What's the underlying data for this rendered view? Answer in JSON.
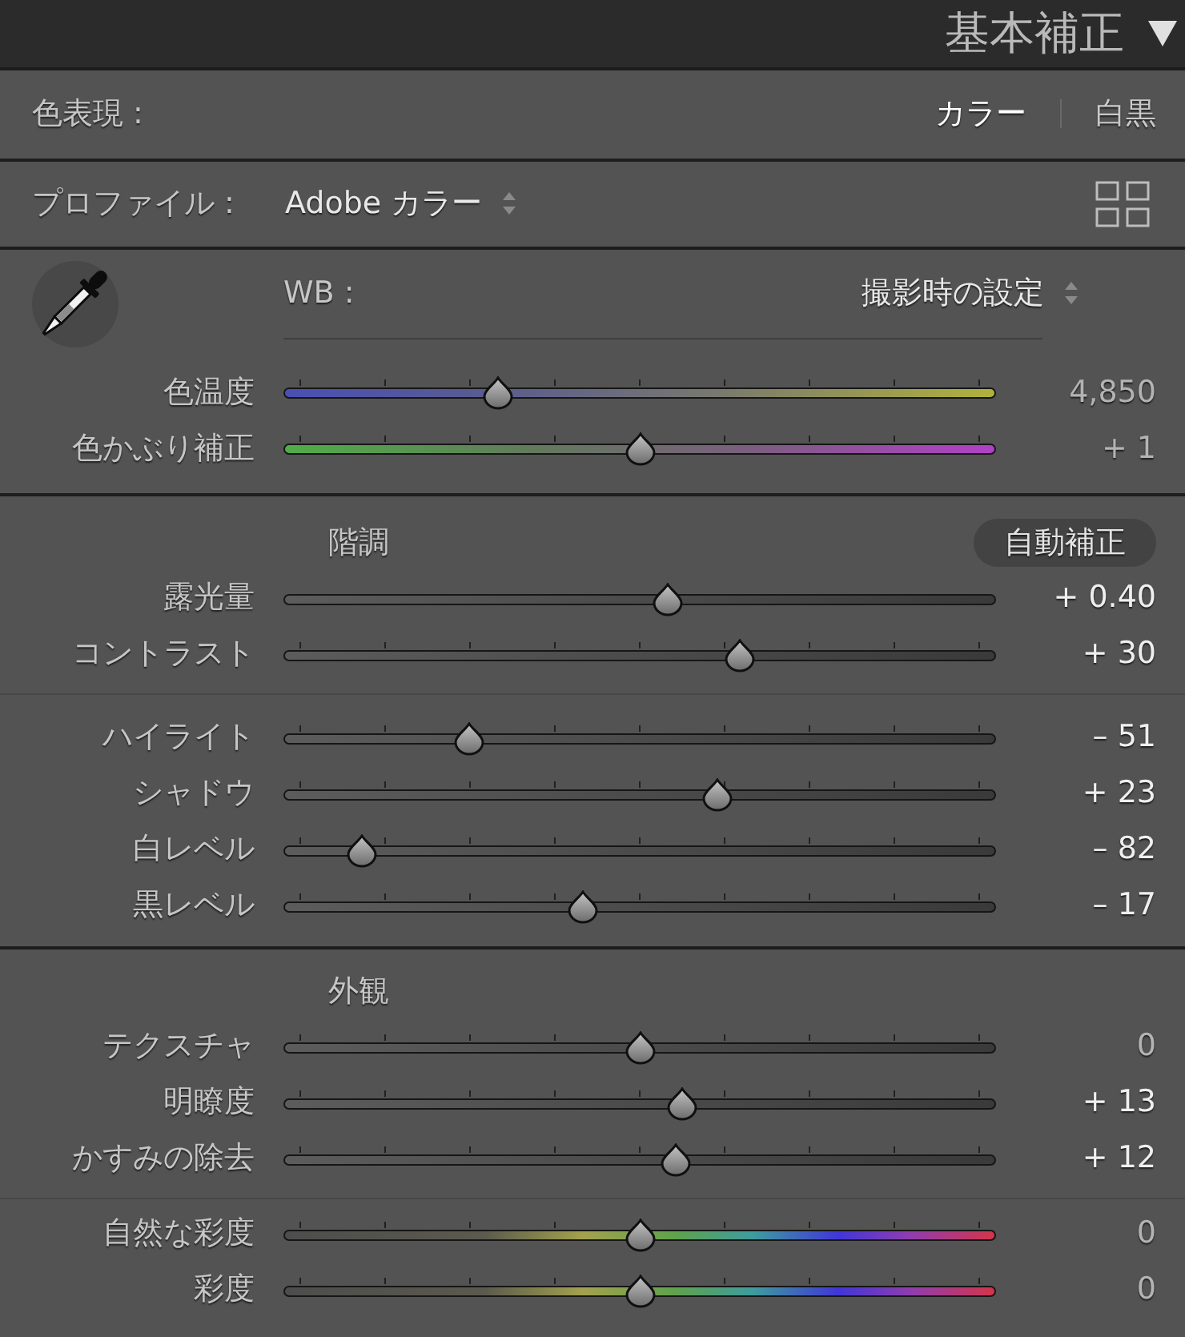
{
  "panel_header": {
    "title": "基本補正"
  },
  "treatment": {
    "label": "色表現 :",
    "options": [
      {
        "label": "カラー",
        "selected": true
      },
      {
        "label": "白黒",
        "selected": false
      }
    ]
  },
  "profile": {
    "label": "プロファイル :",
    "value": "Adobe カラー"
  },
  "white_balance": {
    "label": "WB :",
    "value": "撮影時の設定",
    "sliders": [
      {
        "label": "色温度",
        "kind": "temperature",
        "ticks": true,
        "level": 0.3,
        "reading": "4,850",
        "edited": false
      },
      {
        "label": "色かぶり補正",
        "kind": "tint",
        "ticks": true,
        "level": 0.5,
        "reading": "+ 1",
        "edited": false
      }
    ]
  },
  "tone": {
    "title": "階調",
    "auto_button": "自動補正",
    "groups": [
      {
        "sliders": [
          {
            "label": "露光量",
            "kind": "plain",
            "ticks": false,
            "level": 0.54,
            "reading": "+ 0.40",
            "edited": true
          },
          {
            "label": "コントラスト",
            "kind": "plain",
            "ticks": true,
            "level": 0.64,
            "reading": "+ 30",
            "edited": true
          }
        ]
      },
      {
        "sliders": [
          {
            "label": "ハイライト",
            "kind": "plain",
            "ticks": true,
            "level": 0.26,
            "reading": "– 51",
            "edited": true
          },
          {
            "label": "シャドウ",
            "kind": "plain",
            "ticks": true,
            "level": 0.61,
            "reading": "+ 23",
            "edited": true
          },
          {
            "label": "白レベル",
            "kind": "plain",
            "ticks": true,
            "level": 0.11,
            "reading": "– 82",
            "edited": true
          },
          {
            "label": "黒レベル",
            "kind": "plain",
            "ticks": true,
            "level": 0.42,
            "reading": "– 17",
            "edited": true
          }
        ]
      }
    ]
  },
  "presence": {
    "title": "外観",
    "groups": [
      {
        "sliders": [
          {
            "label": "テクスチャ",
            "kind": "plain",
            "ticks": true,
            "level": 0.5,
            "reading": "0",
            "edited": false
          },
          {
            "label": "明瞭度",
            "kind": "plain",
            "ticks": true,
            "level": 0.56,
            "reading": "+ 13",
            "edited": true
          },
          {
            "label": "かすみの除去",
            "kind": "plain",
            "ticks": true,
            "level": 0.55,
            "reading": "+ 12",
            "edited": true
          }
        ]
      },
      {
        "sliders": [
          {
            "label": "自然な彩度",
            "kind": "spectrum",
            "ticks": true,
            "level": 0.5,
            "reading": "0",
            "edited": false
          },
          {
            "label": "彩度",
            "kind": "spectrum",
            "ticks": true,
            "level": 0.5,
            "reading": "0",
            "edited": false
          }
        ]
      }
    ]
  }
}
